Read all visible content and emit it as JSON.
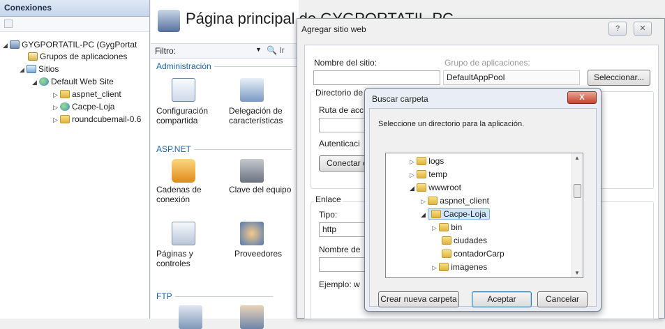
{
  "left_panel": {
    "header": "Conexiones",
    "tree": [
      {
        "label": "GYGPORTATIL-PC (GygPortat",
        "icon": "server-icon"
      },
      {
        "label": "Grupos de aplicaciones",
        "icon": "app-pool-icon"
      },
      {
        "label": "Sitios",
        "icon": "sites-icon"
      },
      {
        "label": "Default Web Site",
        "icon": "globe-icon"
      },
      {
        "label": "aspnet_client",
        "icon": "folder-icon"
      },
      {
        "label": "Cacpe-Loja",
        "icon": "app-icon"
      },
      {
        "label": "roundcubemail-0.6",
        "icon": "folder-icon"
      }
    ]
  },
  "center_panel": {
    "title": "Página principal de GYGPORTATIL-PC",
    "filter_label": "Filtro:",
    "filter_tail": "Ir",
    "sections": {
      "admin": "Administración",
      "aspnet": "ASP.NET",
      "ftp": "FTP"
    },
    "features": {
      "config": "Configuración compartida",
      "delegacion": "Delegación de características",
      "cadenas": "Cadenas de conexión",
      "clave": "Clave del equipo",
      "paginas": "Páginas y controles",
      "proveedores": "Proveedores"
    }
  },
  "add_site_dialog": {
    "title": "Agregar sitio web",
    "help_button": "?",
    "close_button": "✕",
    "site_name_label": "Nombre del sitio:",
    "site_name_value": "",
    "app_pool_label": "Grupo de aplicaciones:",
    "app_pool_value": "DefaultAppPool",
    "select_button": "Seleccionar...",
    "content_dir_label": "Directorio de",
    "physical_path_label": "Ruta de acc",
    "auth_label": "Autenticaci",
    "connect_button": "Conectar c",
    "binding_label": "Enlace",
    "type_label": "Tipo:",
    "type_value": "http",
    "host_label": "Nombre de",
    "example_label": "Ejemplo: w"
  },
  "folder_dialog": {
    "title": "Buscar carpeta",
    "close_button": "X",
    "instruction": "Seleccione un directorio para la aplicación.",
    "tree": [
      {
        "label": "logs",
        "expander": "▷"
      },
      {
        "label": "temp",
        "expander": "▷"
      },
      {
        "label": "wwwroot",
        "expander": "◢"
      },
      {
        "label": "aspnet_client",
        "expander": "▷"
      },
      {
        "label": "Cacpe-Loja",
        "expander": "◢",
        "selected": true
      },
      {
        "label": "bin",
        "expander": "▷"
      },
      {
        "label": "ciudades",
        "expander": ""
      },
      {
        "label": "contadorCarp",
        "expander": ""
      },
      {
        "label": "imagenes",
        "expander": "▷"
      }
    ],
    "new_folder_button": "Crear nueva carpeta",
    "ok_button": "Aceptar",
    "cancel_button": "Cancelar"
  }
}
